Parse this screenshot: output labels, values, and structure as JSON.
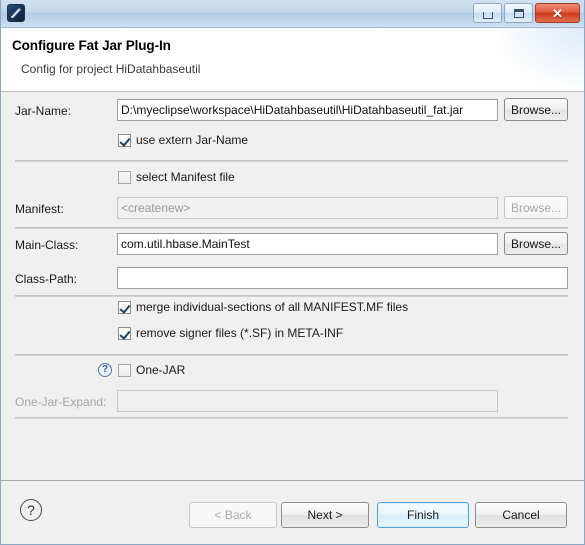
{
  "window": {
    "app_icon": "fatjar-plugin-icon",
    "minimize_label": "Minimize",
    "maximize_label": "Maximize",
    "close_label": "Close",
    "close_glyph": "✕"
  },
  "header": {
    "title": "Configure Fat Jar Plug-In",
    "subtitle": "Config for project HiDatahbaseutil"
  },
  "form": {
    "jar_name": {
      "label": "Jar-Name:",
      "value": "D:\\myeclipse\\workspace\\HiDatahbaseutil\\HiDatahbaseutil_fat.jar",
      "browse_label": "Browse..."
    },
    "use_extern_jar_name": {
      "label": "use extern Jar-Name",
      "checked": "true"
    },
    "select_manifest_file": {
      "label": "select Manifest file",
      "checked": "false"
    },
    "manifest": {
      "label": "Manifest:",
      "value": "<createnew>",
      "browse_label": "Browse...",
      "enabled": "false"
    },
    "main_class": {
      "label": "Main-Class:",
      "value": "com.util.hbase.MainTest",
      "browse_label": "Browse..."
    },
    "class_path": {
      "label": "Class-Path:",
      "value": ""
    },
    "merge_sections": {
      "label": "merge individual-sections of all MANIFEST.MF files",
      "checked": "true"
    },
    "remove_signer": {
      "label": "remove signer files (*.SF) in META-INF",
      "checked": "true"
    },
    "one_jar": {
      "help_glyph": "?",
      "label": "One-JAR",
      "checked": "false"
    },
    "one_jar_expand": {
      "label": "One-Jar-Expand:",
      "value": "",
      "enabled": "false"
    }
  },
  "footer": {
    "help_glyph": "?",
    "back_label": "< Back",
    "next_label": "Next >",
    "finish_label": "Finish",
    "cancel_label": "Cancel"
  },
  "colors": {
    "titlebar": "#c2d6ea",
    "body": "#f0f0f0",
    "close_red": "#cf3b1d",
    "default_button_border": "#4aa7d8",
    "help_blue": "#2f5d8c"
  }
}
